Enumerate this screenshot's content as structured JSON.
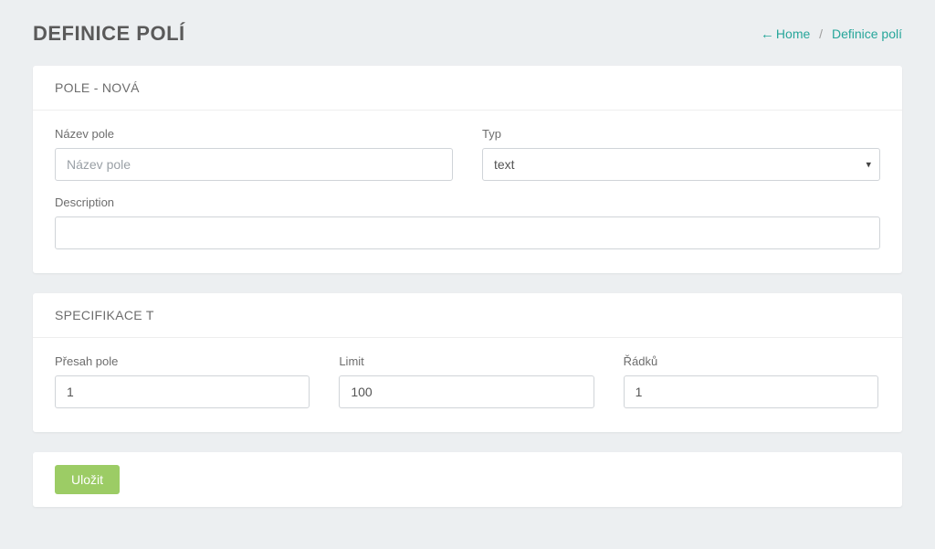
{
  "header": {
    "title": "DEFINICE POLÍ"
  },
  "breadcrumb": {
    "home_label": "Home",
    "separator": "/",
    "current": "Definice polí"
  },
  "card1": {
    "title": "POLE - NOVÁ",
    "name_label": "Název pole",
    "name_placeholder": "Název pole",
    "name_value": "",
    "type_label": "Typ",
    "type_value": "text",
    "description_label": "Description",
    "description_value": ""
  },
  "card2": {
    "title": "SPECIFIKACE T",
    "overlap_label": "Přesah pole",
    "overlap_value": "1",
    "limit_label": "Limit",
    "limit_value": "100",
    "rows_label": "Řádků",
    "rows_value": "1"
  },
  "actions": {
    "save_label": "Uložit"
  }
}
